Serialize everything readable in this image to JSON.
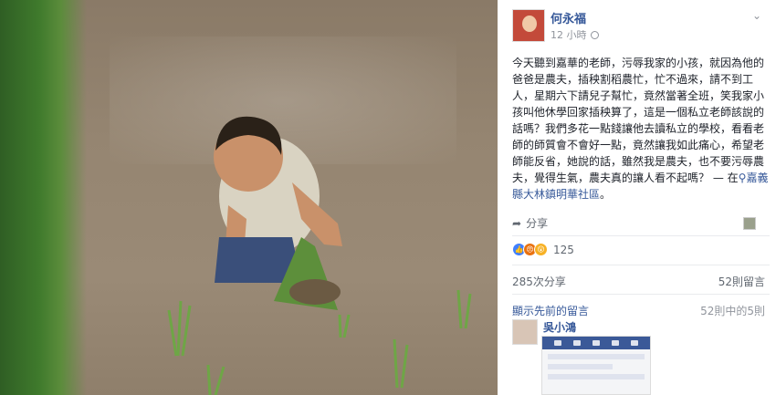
{
  "post": {
    "author": "何永福",
    "time": "12 小時",
    "body": "今天聽到嘉華的老師，污辱我家的小孩，就因為他的爸爸是農夫，插秧割稻農忙，忙不過來，請不到工人，星期六下請兒子幫忙，竟然當著全班，笑我家小孩叫他休學回家插秧算了，這是一個私立老師該說的話嗎？我們多花一點錢讓他去讀私立的學校，看看老師的師質會不會好一點，竟然讓我如此痛心，希望老師能反省，她說的話，雖然我是農夫，也不要污辱農夫，覺得生氣，農夫真的讓人看不起嗎？",
    "location_prefix": " — 在",
    "location": "嘉義縣大林鎮明華社區",
    "location_suffix": "。"
  },
  "actions": {
    "share_label": "分享"
  },
  "stats": {
    "reaction_count": "125",
    "shares": "285次分享",
    "comments": "52則留言"
  },
  "comments_section": {
    "view_previous": "顯示先前的留言",
    "ratio": "52則中的5則",
    "first_comment_author": "吳小鴻"
  },
  "icons": {
    "globe": "globe-icon",
    "chevron": "chevron-down-icon",
    "share": "share-icon",
    "location": "location-pin-icon"
  },
  "colors": {
    "link_blue": "#365899",
    "like_blue": "#4080ff",
    "angry_orange": "#e9710f",
    "wow_yellow": "#f7b125"
  }
}
